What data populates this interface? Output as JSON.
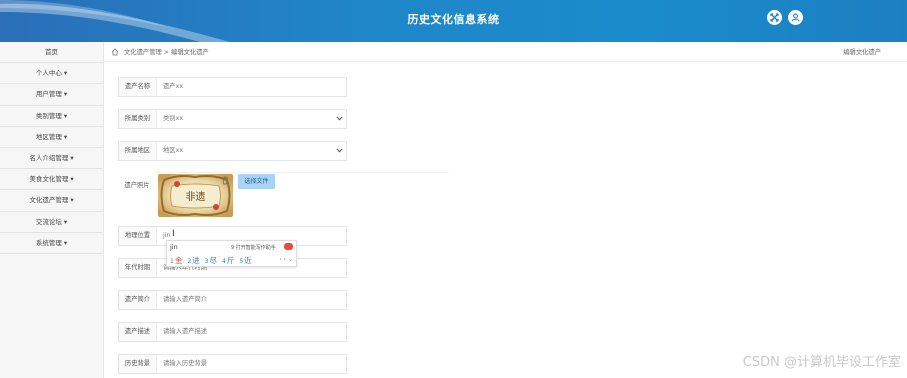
{
  "header": {
    "title": "历史文化信息系统",
    "icons": [
      "fullscreen-icon",
      "user-icon"
    ]
  },
  "sidebar": {
    "items": [
      {
        "label": "首页"
      },
      {
        "label": "个人中心 ▾"
      },
      {
        "label": "用户管理 ▾"
      },
      {
        "label": "类别管理 ▾"
      },
      {
        "label": "地区管理 ▾"
      },
      {
        "label": "名人介绍管理 ▾"
      },
      {
        "label": "美食文化管理 ▾"
      },
      {
        "label": "文化遗产管理 ▾"
      },
      {
        "label": "交流论坛 ▾"
      },
      {
        "label": "系统管理 ▾"
      }
    ]
  },
  "breadcrumb": {
    "path": "文化遗产管理 > 编辑文化遗产",
    "right": "编辑文化遗产"
  },
  "form": {
    "name": {
      "label": "遗产名称",
      "value": "遗产xx"
    },
    "category": {
      "label": "所属类别",
      "value": "类别xx"
    },
    "region": {
      "label": "所属地区",
      "value": "地区xx"
    },
    "photo": {
      "label": "遗产照片",
      "button": "选择文件",
      "thumb_text": "非遗"
    },
    "location": {
      "label": "地理位置",
      "value": "jin"
    },
    "era": {
      "label": "年代时期",
      "placeholder": "请输入年代时期"
    },
    "intro": {
      "label": "遗产简介",
      "placeholder": "请输入遗产简介"
    },
    "desc": {
      "label": "遗产描述",
      "placeholder": "请输入遗产描述"
    },
    "background": {
      "label": "历史背景",
      "placeholder": "请输入历史背景"
    }
  },
  "ime": {
    "composition": "jin",
    "tip": "9 打开智能写作助手",
    "candidates": [
      {
        "n": "1",
        "t": "金"
      },
      {
        "n": "2",
        "t": "进"
      },
      {
        "n": "3",
        "t": "尽"
      },
      {
        "n": "4",
        "t": "斤"
      },
      {
        "n": "5",
        "t": "近"
      }
    ],
    "nav": "‹ › ⌄"
  },
  "watermark": "CSDN @计算机毕设工作室",
  "colors": {
    "header": "#1f86c8",
    "button": "#a8d3f4",
    "ime_accent": "#e24a34"
  }
}
